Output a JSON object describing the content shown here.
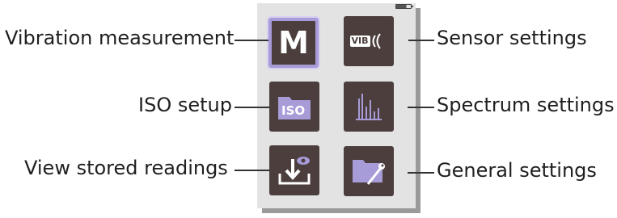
{
  "menu": {
    "items": [
      {
        "label": "Vibration measurement",
        "icon": "letter-m-icon",
        "glyph": "M"
      },
      {
        "label": "Sensor settings",
        "icon": "vib-sensor-icon",
        "badge": "VIB"
      },
      {
        "label": "ISO setup",
        "icon": "iso-folder-icon",
        "badge": "ISO"
      },
      {
        "label": "Spectrum settings",
        "icon": "spectrum-bars-icon"
      },
      {
        "label": "View stored readings",
        "icon": "download-eye-icon"
      },
      {
        "label": "General settings",
        "icon": "folder-wrench-icon"
      }
    ],
    "selected_index": 0
  },
  "colors": {
    "panel": "#e3e3e3",
    "button": "#4b3e3c",
    "accent": "#a79bd8",
    "text": "#1f1f1f"
  }
}
